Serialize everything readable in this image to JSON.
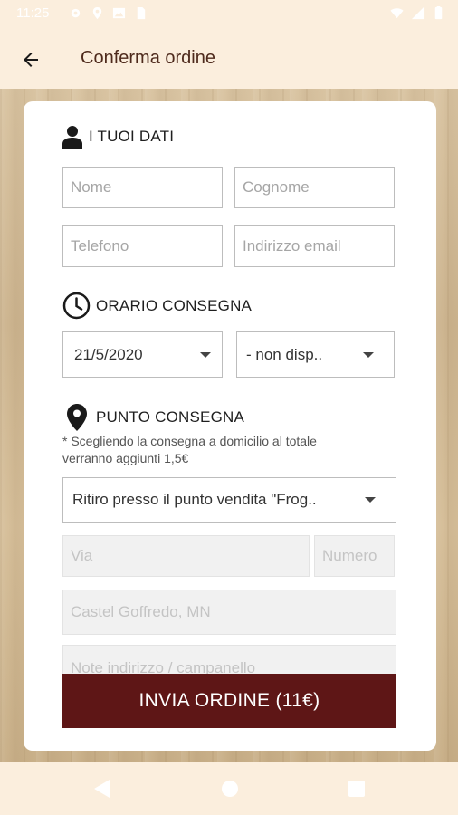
{
  "status_bar": {
    "time": "11:25",
    "left_icons": [
      "gear-icon",
      "location-icon",
      "image-icon",
      "sim-icon"
    ],
    "right_icons": [
      "wifi-icon",
      "signal-icon",
      "battery-icon"
    ]
  },
  "app_bar": {
    "back_icon": "arrow-left-icon",
    "title": "Conferma ordine"
  },
  "section_personal": {
    "icon": "person-icon",
    "title": "I TUOI DATI",
    "fields": {
      "first_name_placeholder": "Nome",
      "last_name_placeholder": "Cognome",
      "phone_placeholder": "Telefono",
      "email_placeholder": "Indirizzo email"
    }
  },
  "section_time": {
    "icon": "clock-icon",
    "title": "ORARIO CONSEGNA",
    "date_value": "21/5/2020",
    "time_value": "- non disp.."
  },
  "section_delivery": {
    "icon": "map-pin-icon",
    "title": "PUNTO CONSEGNA",
    "note": "* Scegliendo la consegna a domicilio al totale verranno aggiunti 1,5€",
    "option_value": "Ritiro presso il punto vendita \"Frog..",
    "street_placeholder": "Via",
    "number_placeholder": "Numero",
    "city_placeholder": "Castel Goffredo, MN",
    "address_note_placeholder": "Note indirizzo / campanello"
  },
  "submit_label": "INVIA ORDINE (11€)",
  "colors": {
    "background": "#fbeedd",
    "title": "#4e2a1c",
    "button": "#5e1616"
  },
  "nav_bar": [
    "back-triangle-icon",
    "home-circle-icon",
    "recents-square-icon"
  ]
}
